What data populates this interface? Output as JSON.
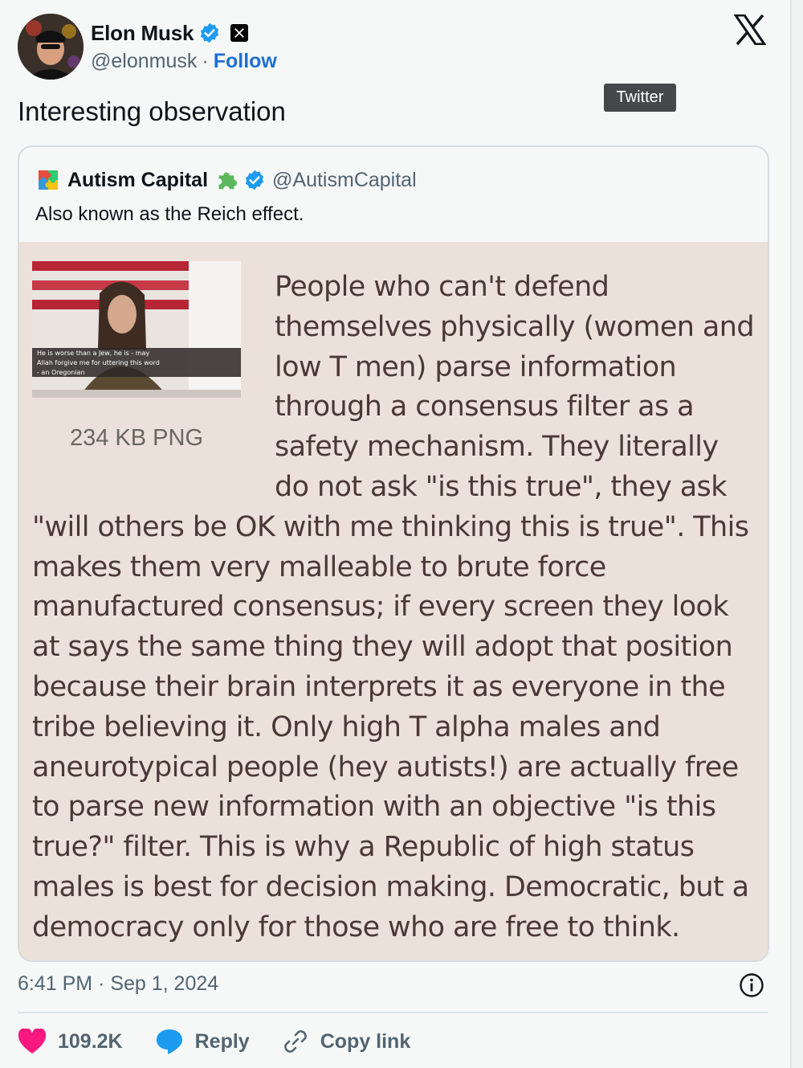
{
  "author": {
    "name": "Elon Musk",
    "handle": "@elonmusk",
    "separator": "·",
    "follow_label": "Follow"
  },
  "tooltip": "Twitter",
  "tweet_text": "Interesting observation",
  "quote": {
    "name": "Autism Capital",
    "handle": "@AutismCapital",
    "text": "Also known as the Reich effect.",
    "media": {
      "file_info": "234 KB PNG",
      "thumb_caption_1": "He is worse than a Jew, he is - may",
      "thumb_caption_2": "Allah forgive me for uttering this word",
      "thumb_caption_3": "- an Oregonian",
      "body": "People who can't defend themselves physically (women and low T men) parse information through a consensus filter as a safety mechanism. They literally do not ask \"is this true\", they ask \"will others be OK with me thinking this is true\". This makes them very malleable to brute force manufactured consensus; if every screen they look at says the same thing they will adopt that position because their brain interprets it as everyone in the tribe believing it. Only high T alpha males and aneurotypical people (hey autists!) are actually free to parse new information with an objective \"is this true?\" filter. This is why a Republic of high status males is best for decision making. Democratic, but a democracy only for those who are free to think."
    }
  },
  "timestamp": "6:41 PM · Sep 1, 2024",
  "actions": {
    "likes": "109.2K",
    "reply": "Reply",
    "copy_link": "Copy link"
  },
  "colors": {
    "link": "#1d6fd3",
    "verified": "#1d9bf0",
    "like": "#f91880",
    "reply_icon": "#1d9bf0",
    "meme_bg": "#ece1da",
    "meme_text": "#4a3838"
  }
}
